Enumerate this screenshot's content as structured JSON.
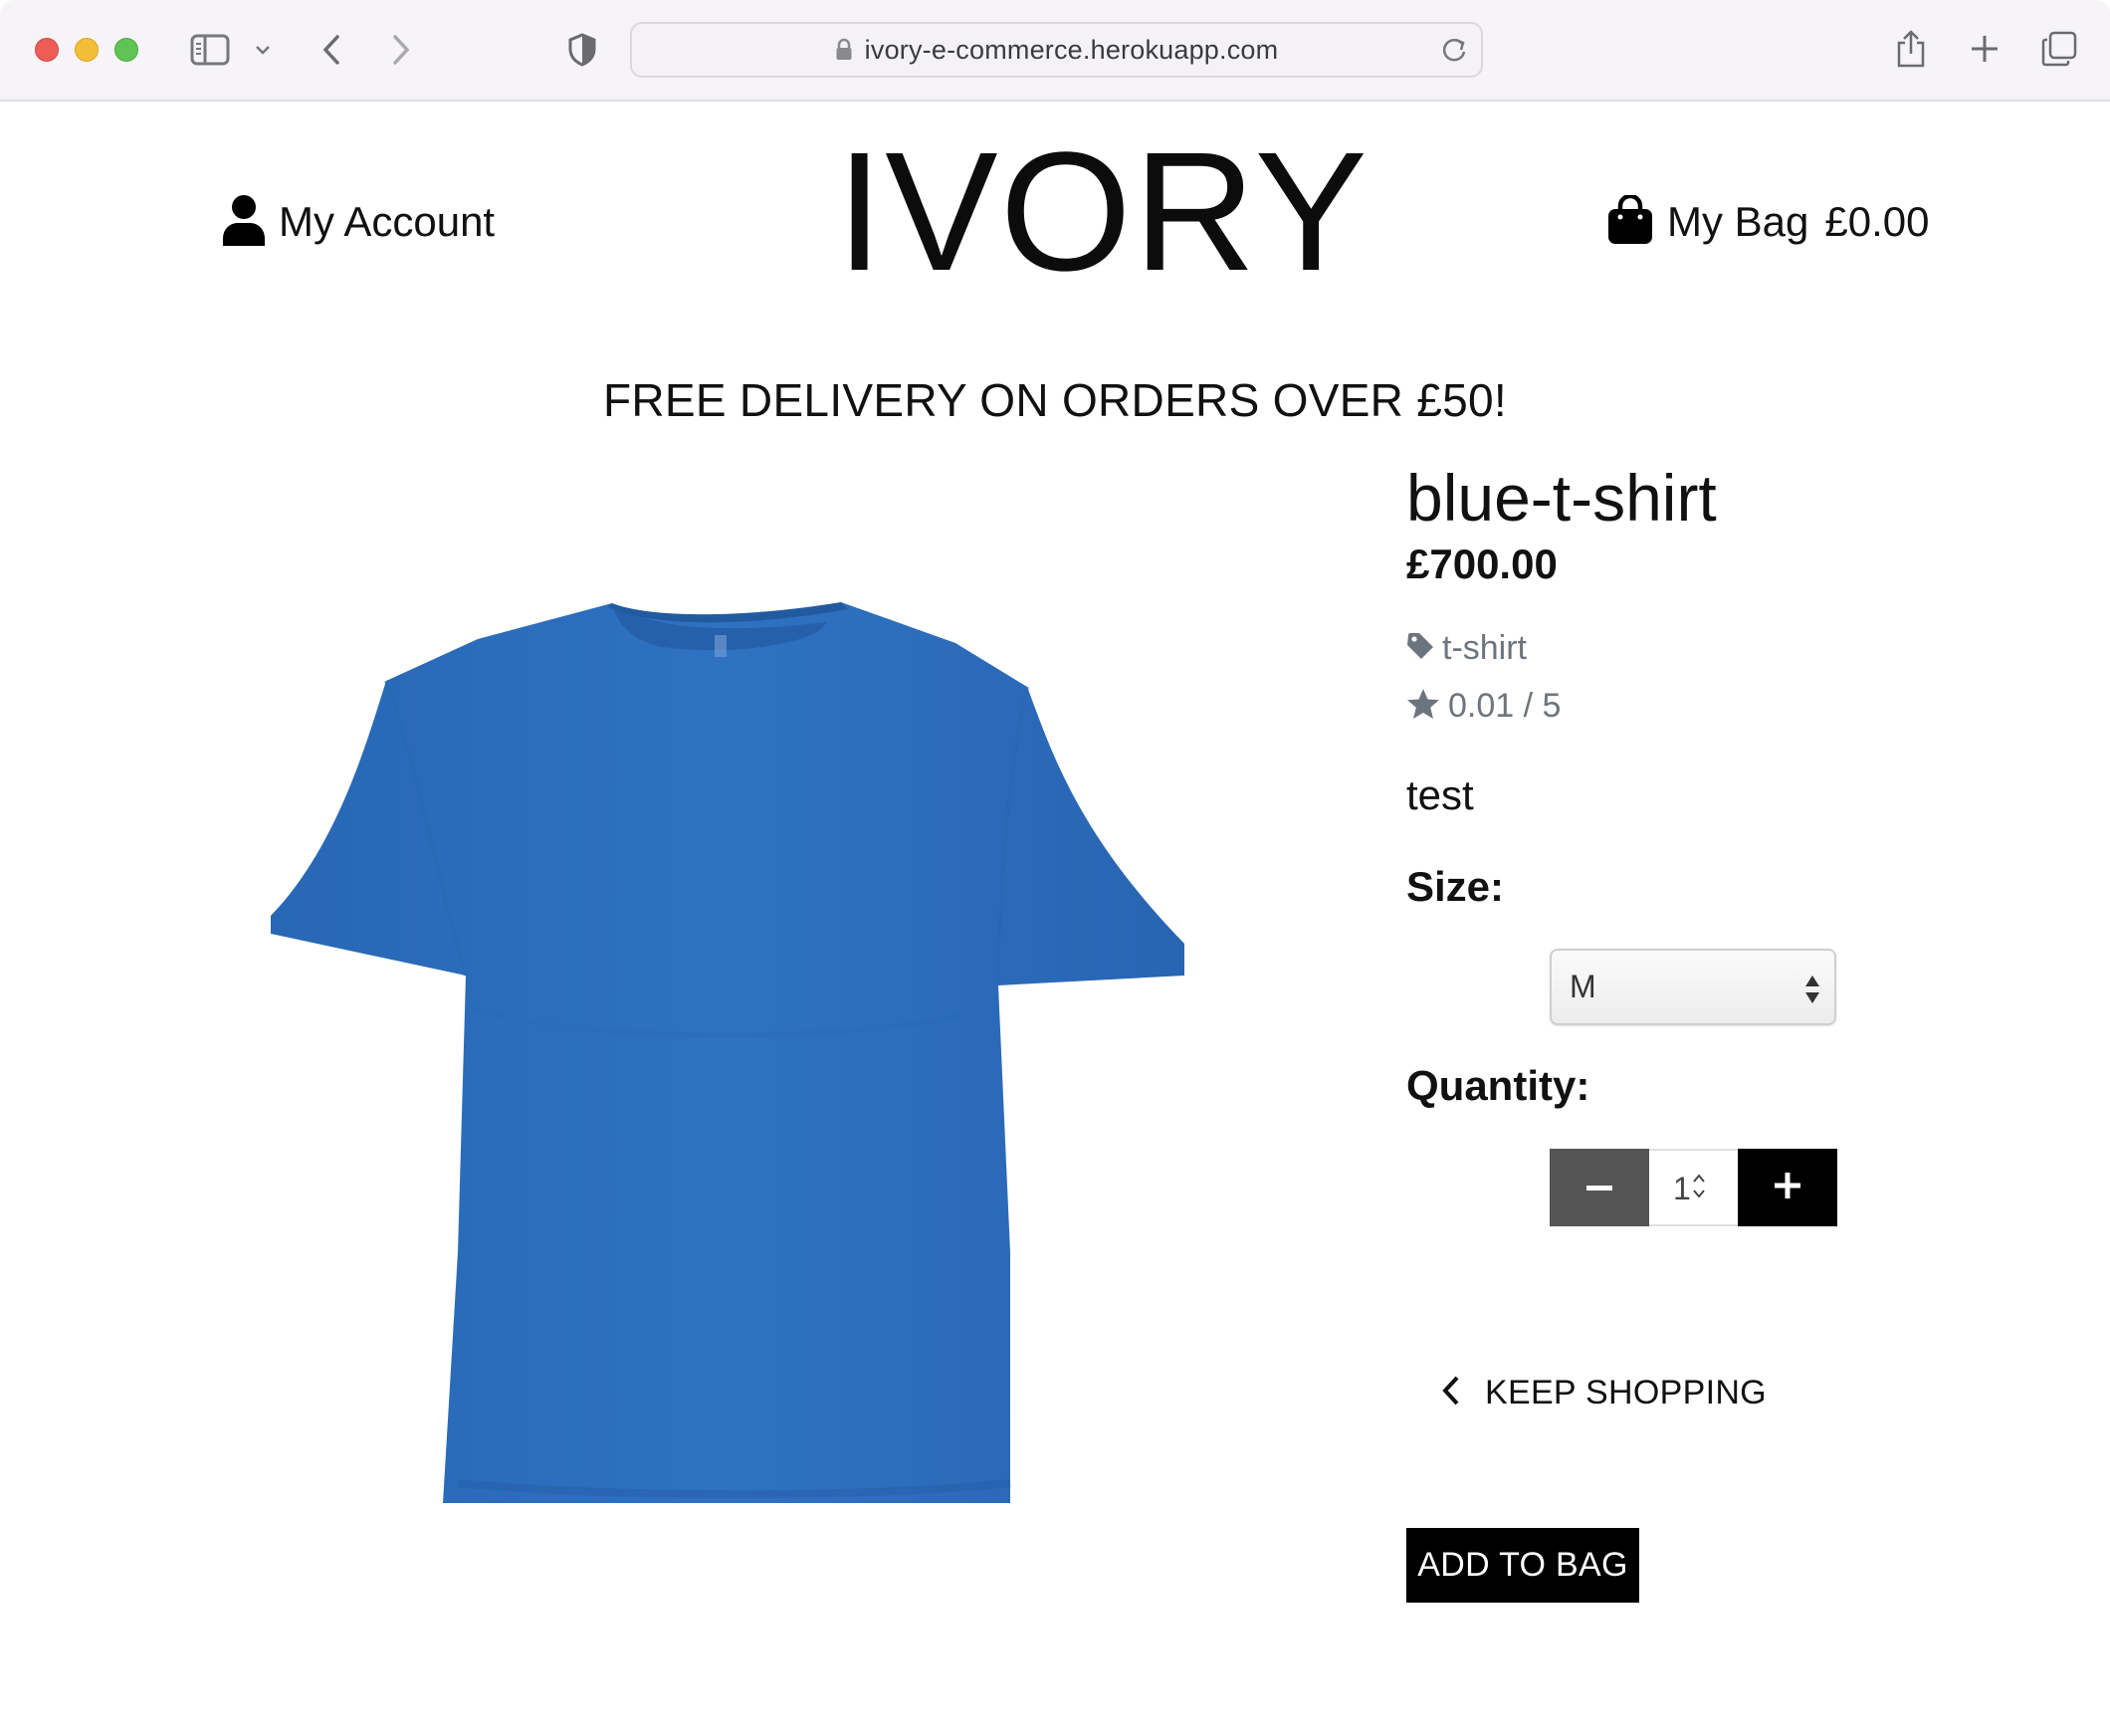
{
  "browser": {
    "url": "ivory-e-commerce.herokuapp.com"
  },
  "header": {
    "account_label": "My Account",
    "logo": "IVORY",
    "bag_label": "My Bag",
    "bag_total": "£0.00"
  },
  "banner": "FREE DELIVERY ON ORDERS OVER £50!",
  "product": {
    "name": "blue-t-shirt",
    "price": "£700.00",
    "category": "t-shirt",
    "rating": "0.01 / 5",
    "description": "test",
    "image_color": "#2f72c2"
  },
  "form": {
    "size_label": "Size:",
    "size_value": "M",
    "quantity_label": "Quantity:",
    "quantity_value": "1"
  },
  "actions": {
    "keep_shopping": "KEEP SHOPPING",
    "add_to_bag": "ADD TO BAG"
  }
}
